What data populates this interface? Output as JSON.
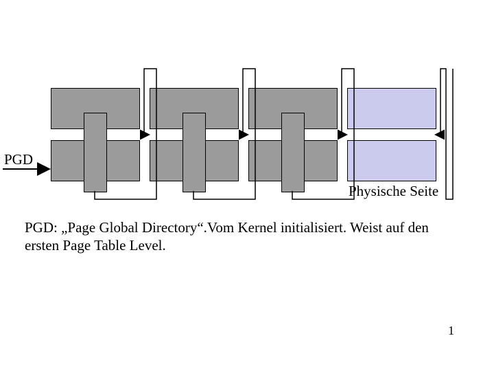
{
  "labels": {
    "pgd": "PGD",
    "phys": "Physische Seite"
  },
  "description": "PGD: „Page Global Directory“.Vom Kernel initialisiert. Weist auf den ersten Page Table Level.",
  "pagenum": "1",
  "colors": {
    "grey": "#9b9b9b",
    "blue": "#cbcbed"
  }
}
